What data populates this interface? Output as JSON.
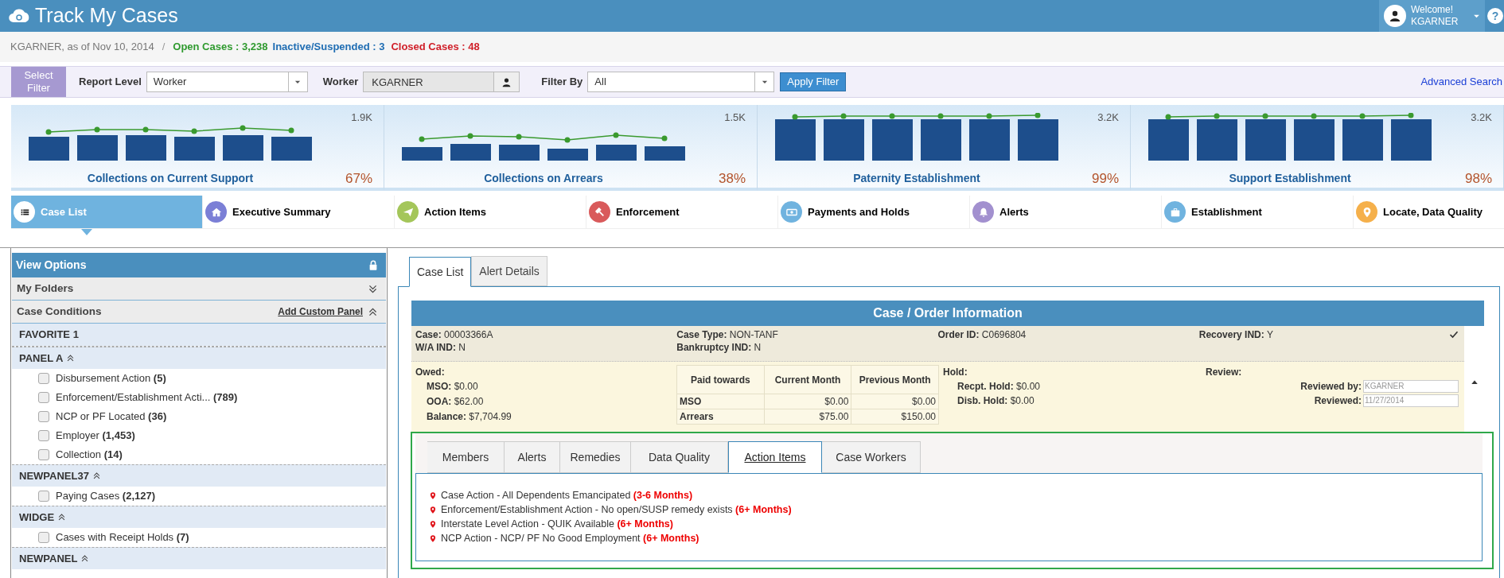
{
  "header": {
    "title": "Track My Cases",
    "welcome": "Welcome!",
    "user": "KGARNER",
    "help": "?"
  },
  "status": {
    "user_date": "KGARNER, as of Nov 10, 2014",
    "separator": "/",
    "open": "Open Cases : 3,238",
    "inactive": "Inactive/Suspended : 3",
    "closed": "Closed Cases : 48"
  },
  "filter": {
    "select_filter": "Select Filter",
    "report_level_label": "Report Level",
    "report_level": "Worker",
    "worker_label": "Worker",
    "worker": "KGARNER",
    "filter_by_label": "Filter By",
    "filter_by": "All",
    "apply": "Apply Filter",
    "advanced": "Advanced Search"
  },
  "kpis": [
    {
      "title": "Collections on Current Support",
      "max": "1.9K",
      "percent": "67%"
    },
    {
      "title": "Collections on Arrears",
      "max": "1.5K",
      "percent": "38%"
    },
    {
      "title": "Paternity Establishment",
      "max": "3.2K",
      "percent": "99%"
    },
    {
      "title": "Support Establishment",
      "max": "3.2K",
      "percent": "98%"
    }
  ],
  "nav_tabs": [
    {
      "label": "Case List",
      "selected": true,
      "color": "#ffffff"
    },
    {
      "label": "Executive Summary",
      "selected": false,
      "color": "#7b7fd6"
    },
    {
      "label": "Action Items",
      "selected": false,
      "color": "#a4c65a"
    },
    {
      "label": "Enforcement",
      "selected": false,
      "color": "#d95a5b"
    },
    {
      "label": "Payments and Holds",
      "selected": false,
      "color": "#70b3df"
    },
    {
      "label": "Alerts",
      "selected": false,
      "color": "#a290cf"
    },
    {
      "label": "Establishment",
      "selected": false,
      "color": "#70b3df"
    },
    {
      "label": "Locate, Data Quality",
      "selected": false,
      "color": "#f5b04b"
    }
  ],
  "view_options": {
    "title": "View Options",
    "my_folders": "My Folders",
    "case_conditions": "Case Conditions",
    "add_custom_panel": "Add Custom Panel",
    "panels": [
      {
        "name": "FAVORITE 1",
        "kind": "favorite"
      },
      {
        "name": "PANEL A",
        "kind": "panel",
        "items": [
          {
            "label": "Disbursement Action",
            "count": "(5)",
            "checked": false
          },
          {
            "label": "Enforcement/Establishment Acti...",
            "count": "(789)",
            "checked": false
          },
          {
            "label": "NCP or PF Located",
            "count": "(36)",
            "checked": false
          },
          {
            "label": "Employer",
            "count": "(1,453)",
            "checked": false
          },
          {
            "label": "Collection",
            "count": "(14)",
            "checked": false
          }
        ]
      },
      {
        "name": "NEWPANEL37",
        "kind": "panel",
        "items": [
          {
            "label": "Paying Cases",
            "count": "(2,127)",
            "checked": false
          }
        ]
      },
      {
        "name": "WIDGE",
        "kind": "panel",
        "items": [
          {
            "label": "Cases with Receipt Holds",
            "count": "(7)",
            "checked": false
          }
        ]
      },
      {
        "name": "NEWPANEL",
        "kind": "panel"
      }
    ]
  },
  "main_tabs": [
    {
      "label": "Case List",
      "selected": true
    },
    {
      "label": "Alert Details",
      "selected": false
    }
  ],
  "case_info": {
    "title": "Case / Order Information",
    "summary_columns": [
      [
        {
          "label": "Case:",
          "value": "00003366A"
        },
        {
          "label": "W/A IND:",
          "value": "N"
        }
      ],
      [
        {
          "label": "Case Type:",
          "value": "NON-TANF"
        },
        {
          "label": "Bankruptcy IND:",
          "value": "N"
        }
      ],
      [
        {
          "label": "Order ID:",
          "value": "C0696804"
        }
      ],
      [
        {
          "label": "Recovery IND:",
          "value": "Y"
        }
      ]
    ],
    "owed": {
      "title": "Owed:",
      "items": [
        {
          "label": "MSO:",
          "value": "$0.00"
        },
        {
          "label": "OOA:",
          "value": "$62.00"
        },
        {
          "label": "Balance:",
          "value": "$7,704.99"
        }
      ]
    },
    "paid_table": {
      "columns": [
        "Paid towards",
        "Current Month",
        "Previous Month"
      ],
      "rows": [
        [
          "MSO",
          "$0.00",
          "$0.00"
        ],
        [
          "Arrears",
          "$75.00",
          "$150.00"
        ]
      ]
    },
    "hold": {
      "title": "Hold:",
      "items": [
        {
          "label": "Recpt. Hold:",
          "value": "$0.00"
        },
        {
          "label": "Disb. Hold:",
          "value": "$0.00"
        }
      ]
    },
    "review": {
      "title": "Review:",
      "fields": [
        {
          "label": "Reviewed by:",
          "value": "KGARNER"
        },
        {
          "label": "Reviewed:",
          "value": "11/27/2014"
        }
      ]
    }
  },
  "sub_tabs": [
    {
      "label": "Members",
      "selected": false
    },
    {
      "label": "Alerts",
      "selected": false
    },
    {
      "label": "Remedies",
      "selected": false
    },
    {
      "label": "Data Quality",
      "selected": false
    },
    {
      "label": "Action Items",
      "selected": true
    },
    {
      "label": "Case Workers",
      "selected": false
    }
  ],
  "action_items": [
    {
      "text": "Case Action - All Dependents Emancipated",
      "tag": "(3-6 Months)"
    },
    {
      "text": "Enforcement/Establishment Action - No open/SUSP remedy exists",
      "tag": "(6+ Months)"
    },
    {
      "text": "Interstate Level Action - QUIK Available",
      "tag": "(6+ Months)"
    },
    {
      "text": "NCP Action - NCP/ PF No Good Employment",
      "tag": "(6+ Months)"
    }
  ]
}
